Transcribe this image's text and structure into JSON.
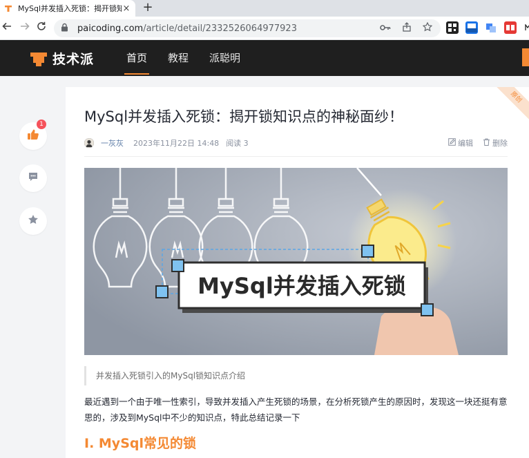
{
  "browser": {
    "tab_title": "MySql并发插入死锁：揭开锁知识点",
    "tab_close": "×",
    "new_tab": "+",
    "url_host": "paicoding.com",
    "url_path": "/article/detail/2332526064977923"
  },
  "site": {
    "logo_text": "技术派",
    "nav": [
      "首页",
      "教程",
      "派聪明"
    ],
    "accent_color": "#f48933"
  },
  "actions": {
    "like_count": "1"
  },
  "article": {
    "badge": "原创",
    "title": "MySql并发插入死锁：揭开锁知识点的神秘面纱！",
    "author": "一灰灰",
    "date": "2023年11月22日 14:48",
    "reads": "阅读 3",
    "edit_label": "编辑",
    "delete_label": "删除",
    "hero_text": "MySql并发插入死锁",
    "summary": "并发插入死锁引入的MySql锁知识点介绍",
    "paragraph": "最近遇到一个由于唯一性索引，导致并发插入产生死锁的场景，在分析死锁产生的原因时，发现这一块还挺有意思的，涉及到MySql中不少的知识点，特此总结记录一下",
    "section_heading": "I. MySql常见的锁"
  }
}
